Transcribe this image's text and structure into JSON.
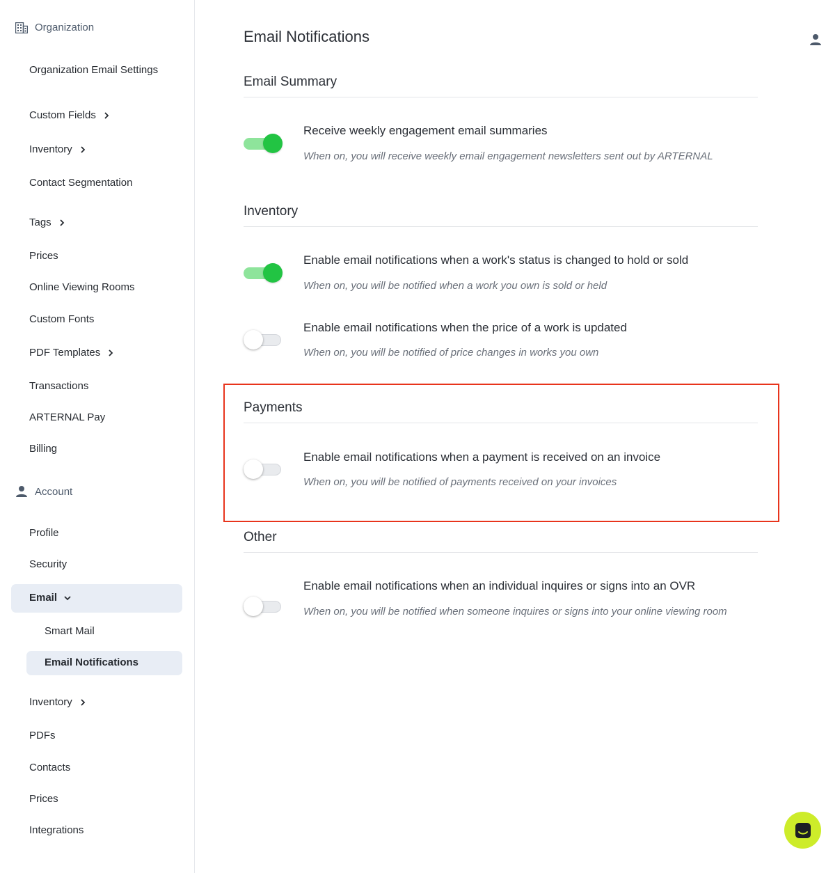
{
  "sidebar": {
    "organization": {
      "header": "Organization",
      "items": [
        {
          "label": "Organization Email Settings"
        },
        {
          "label": "Custom Fields"
        },
        {
          "label": "Inventory"
        },
        {
          "label": "Contact Segmentation"
        },
        {
          "label": "Tags"
        },
        {
          "label": "Prices"
        },
        {
          "label": "Online Viewing Rooms"
        },
        {
          "label": "Custom Fonts"
        },
        {
          "label": "PDF Templates"
        },
        {
          "label": "Transactions"
        },
        {
          "label": "ARTERNAL Pay"
        },
        {
          "label": "Billing"
        }
      ]
    },
    "account": {
      "header": "Account",
      "items": [
        {
          "label": "Profile"
        },
        {
          "label": "Security"
        },
        {
          "label": "Email"
        },
        {
          "label": "Smart Mail"
        },
        {
          "label": "Email Notifications"
        },
        {
          "label": "Inventory"
        },
        {
          "label": "PDFs"
        },
        {
          "label": "Contacts"
        },
        {
          "label": "Prices"
        },
        {
          "label": "Integrations"
        }
      ]
    }
  },
  "main": {
    "title": "Email Notifications",
    "groups": [
      {
        "title": "Email Summary",
        "options": [
          {
            "title": "Receive weekly engagement email summaries",
            "description": "When on, you will receive weekly email engagement newsletters sent out by ARTERNAL",
            "enabled": true
          }
        ]
      },
      {
        "title": "Inventory",
        "options": [
          {
            "title": "Enable email notifications when a work's status is changed to hold or sold",
            "description": "When on, you will be notified when a work you own is sold or held",
            "enabled": true
          },
          {
            "title": "Enable email notifications when the price of a work is updated",
            "description": "When on, you will be notified of price changes in works you own",
            "enabled": false
          }
        ]
      },
      {
        "title": "Payments",
        "options": [
          {
            "title": "Enable email notifications when a payment is received on an invoice",
            "description": "When on, you will be notified of payments received on your invoices",
            "enabled": false
          }
        ]
      },
      {
        "title": "Other",
        "options": [
          {
            "title": "Enable email notifications when an individual inquires or signs into an OVR",
            "description": "When on, you will be notified when someone inquires or signs into your online viewing room",
            "enabled": false
          }
        ]
      }
    ]
  },
  "colors": {
    "toggle_on": "#22c443",
    "toggle_on_track": "#8ee49b",
    "highlight": "#e8341c",
    "active_bg": "#e8edf5",
    "chat_button": "#cdec2a"
  },
  "icons": [
    "building-icon",
    "person-icon",
    "chevron-right-icon",
    "chevron-down-icon",
    "user-icon",
    "chat-icon"
  ]
}
